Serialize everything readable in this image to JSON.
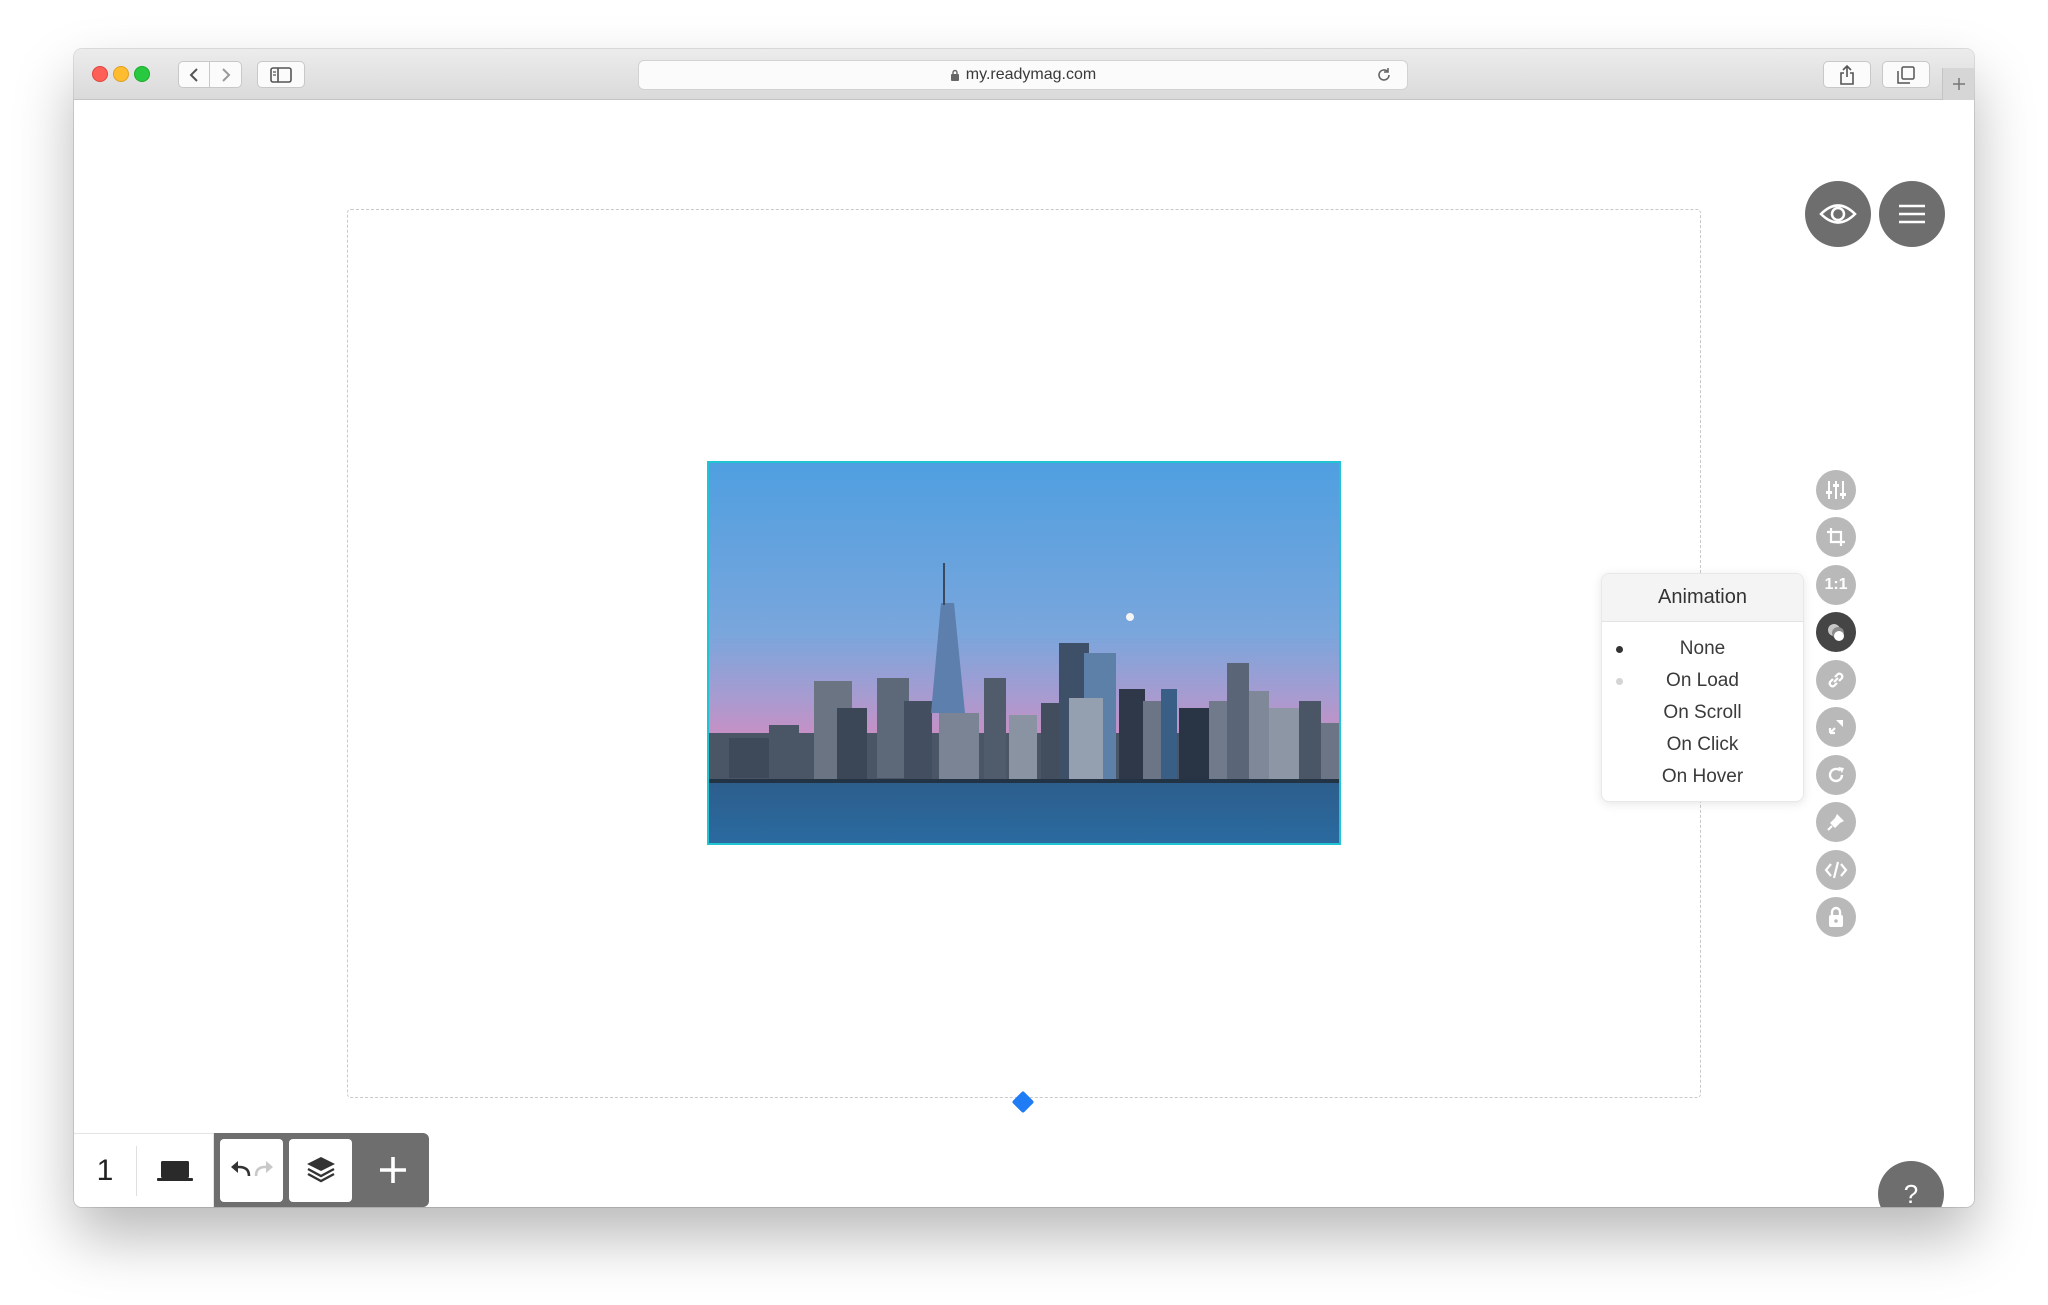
{
  "browser": {
    "url": "my.readymag.com",
    "traffic_lights": {
      "close": "#fe5f57",
      "minimize": "#febc2e",
      "zoom": "#28c840"
    }
  },
  "editor": {
    "preview_icon": "eye-icon",
    "menu_icon": "hamburger-menu-icon",
    "tools": [
      {
        "name": "adjustments-icon",
        "label": ""
      },
      {
        "name": "crop-icon",
        "label": ""
      },
      {
        "name": "aspect-ratio-button",
        "label": "1:1"
      },
      {
        "name": "animation-icon",
        "label": ""
      },
      {
        "name": "link-icon",
        "label": ""
      },
      {
        "name": "pin-fit-icon",
        "label": ""
      },
      {
        "name": "rotate-icon",
        "label": ""
      },
      {
        "name": "pin-icon",
        "label": ""
      },
      {
        "name": "code-icon",
        "label": ""
      },
      {
        "name": "lock-icon",
        "label": ""
      }
    ],
    "animation_panel": {
      "title": "Animation",
      "options": [
        "None",
        "On Load",
        "On Scroll",
        "On Click",
        "On Hover"
      ],
      "selected": "None"
    },
    "help_label": "?",
    "bottom_bar": {
      "page_number": "1",
      "device_icon": "laptop-icon",
      "undo_icon": "undo-icon",
      "redo_icon": "redo-icon",
      "layers_icon": "layers-icon",
      "add_icon": "plus-icon"
    },
    "colors": {
      "accent": "#1f7cf5",
      "selection": "#20c4d2",
      "button_dark": "#6e6e6e",
      "tool_gray": "#b9b9b9"
    }
  }
}
